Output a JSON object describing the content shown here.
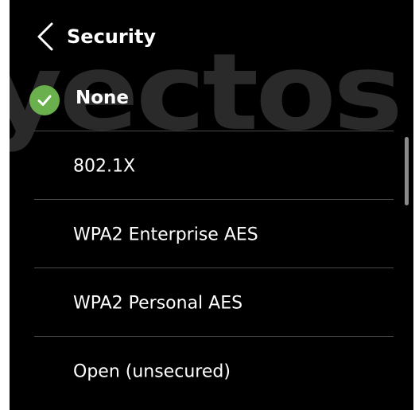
{
  "watermark": {
    "text": "yectos"
  },
  "header": {
    "title": "Security",
    "back_icon": "chevron-left-icon"
  },
  "selected": {
    "label": "None",
    "icon": "check-circle-icon",
    "icon_color": "#6ab04c"
  },
  "options": [
    {
      "label": "802.1X"
    },
    {
      "label": "WPA2 Enterprise AES"
    },
    {
      "label": "WPA2 Personal AES"
    },
    {
      "label": "Open (unsecured)"
    }
  ],
  "colors": {
    "background": "#000000",
    "text": "#ffffff",
    "divider": "#4a4a4a",
    "accent": "#6ab04c"
  }
}
